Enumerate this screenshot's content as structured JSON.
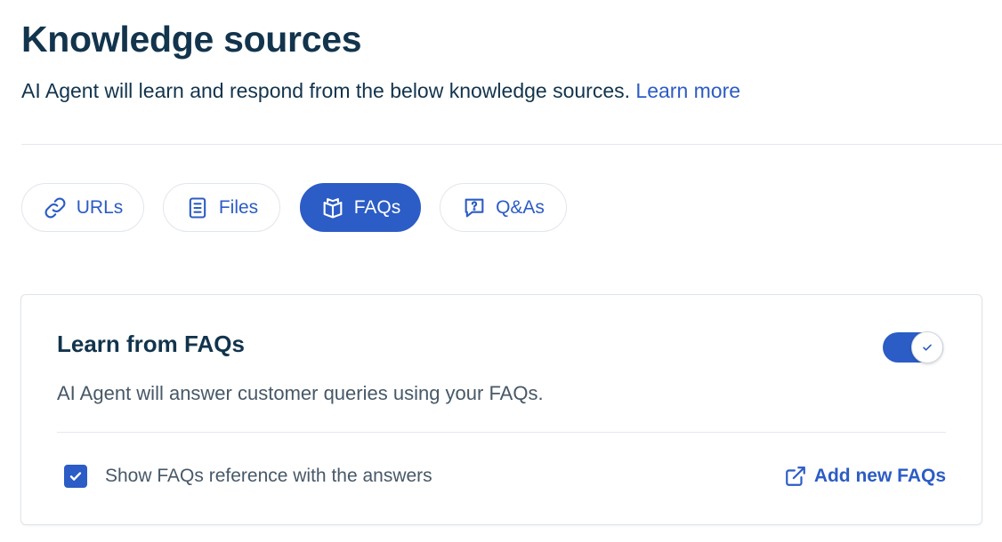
{
  "header": {
    "title": "Knowledge sources",
    "subtitle": "AI Agent will learn and respond from the below knowledge sources.",
    "learn_more": "Learn more"
  },
  "tabs": [
    {
      "label": "URLs",
      "icon": "link-icon",
      "active": false
    },
    {
      "label": "Files",
      "icon": "file-icon",
      "active": false
    },
    {
      "label": "FAQs",
      "icon": "book-icon",
      "active": true
    },
    {
      "label": "Q&As",
      "icon": "question-chat-icon",
      "active": false
    }
  ],
  "faq_card": {
    "title": "Learn from FAQs",
    "description": "AI Agent will answer customer queries using your FAQs.",
    "toggle_on": true,
    "checkbox_label": "Show FAQs reference with the answers",
    "checkbox_checked": true,
    "add_link": "Add new FAQs",
    "add_link_icon": "external-link-icon"
  },
  "colors": {
    "primary": "#2c5cc5",
    "heading": "#12344d",
    "body": "#475867",
    "border": "#e1e6ec"
  }
}
